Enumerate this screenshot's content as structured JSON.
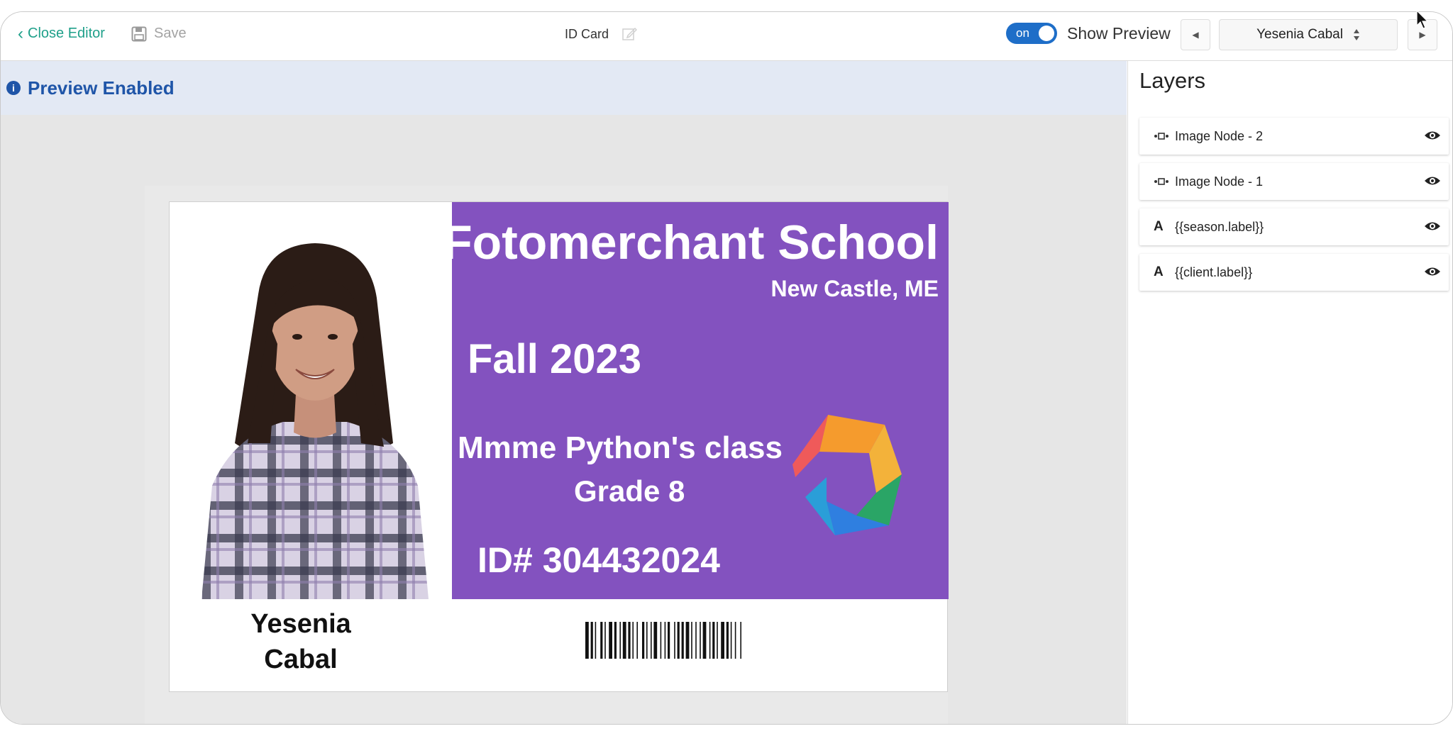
{
  "topbar": {
    "close_label": "Close Editor",
    "save_label": "Save",
    "doc_title": "ID Card",
    "toggle_label": "on",
    "show_preview_label": "Show Preview",
    "person_selected": "Yesenia Cabal",
    "toggle_on": true
  },
  "banner": {
    "text": "Preview Enabled"
  },
  "card": {
    "school": "Fotomerchant School",
    "city": "New Castle, ME",
    "season": "Fall 2023",
    "class_name": "Mmme Python's class",
    "grade": "Grade 8",
    "id_number": "ID# 304432024",
    "first_name": "Yesenia",
    "last_name": "Cabal",
    "background_color": "#8352bf"
  },
  "layers": {
    "title": "Layers",
    "items": [
      {
        "label": "Image Node - 2",
        "icon": "image-node-icon"
      },
      {
        "label": "Image Node - 1",
        "icon": "image-node-icon"
      },
      {
        "label": "{{season.label}}",
        "icon": "text-icon",
        "glyph": "A"
      },
      {
        "label": "{{client.label}}",
        "icon": "text-icon",
        "glyph": "A"
      }
    ]
  },
  "colors": {
    "accent_green": "#1fa08a",
    "toggle_blue": "#1e6ec8",
    "banner_blue": "#1f55a8"
  }
}
